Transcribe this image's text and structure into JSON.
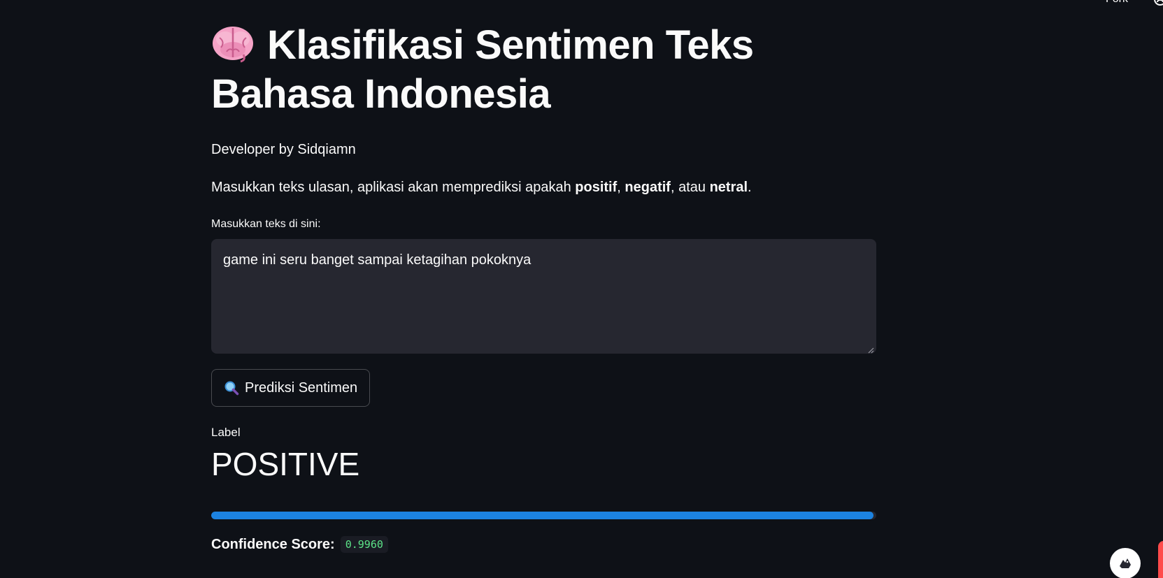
{
  "topbar": {
    "fork_label": "Fork",
    "github_icon": "github-icon"
  },
  "header": {
    "emoji_icon": "brain-icon",
    "title": "Klasifikasi Sentimen Teks Bahasa Indonesia"
  },
  "developer": "Developer by Sidqiamn",
  "description": {
    "prefix": "Masukkan teks ulasan, aplikasi akan memprediksi apakah ",
    "positive": "positif",
    "sep1": ", ",
    "negative": "negatif",
    "sep2": ", atau ",
    "neutral": "netral",
    "suffix": "."
  },
  "input": {
    "label": "Masukkan teks di sini:",
    "value": "game ini seru banget sampai ketagihan pokoknya"
  },
  "predict_button": {
    "icon": "magnifier-icon",
    "label": "Prediksi Sentimen"
  },
  "result": {
    "label": "Label",
    "value": "POSITIVE"
  },
  "progress": {
    "fraction": 0.996
  },
  "confidence": {
    "label": "Confidence Score:",
    "value": "0.9960"
  },
  "colors": {
    "background": "#0e1117",
    "text": "#fafafa",
    "input_bg": "#262730",
    "progress": "#1c83e1",
    "code_green": "#5ce488",
    "accent_red": "#ff4b4b"
  }
}
